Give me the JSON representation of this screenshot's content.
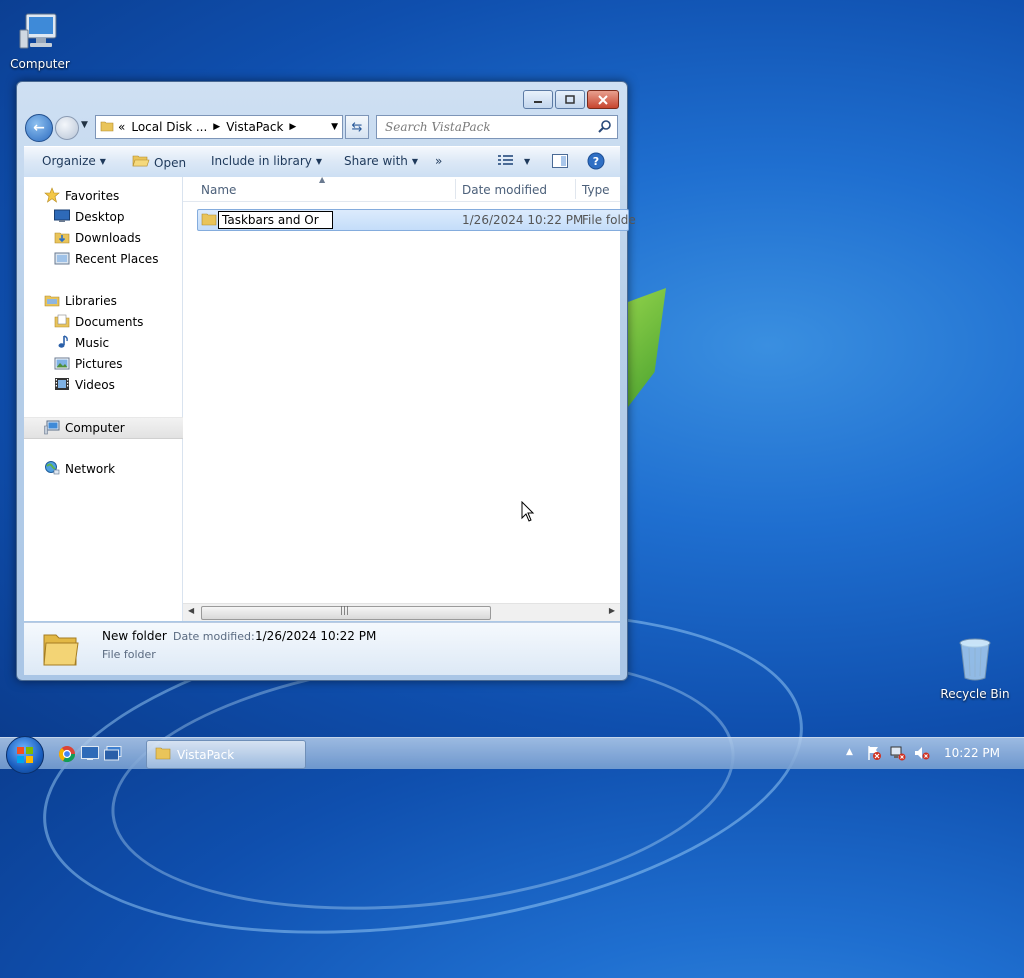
{
  "desktop": {
    "icons": [
      {
        "label": "Computer"
      },
      {
        "label": "Recycle Bin"
      }
    ]
  },
  "window": {
    "address": {
      "overflow": "«",
      "crumbs": [
        "Local Disk ...",
        "VistaPack"
      ]
    },
    "search_placeholder": "Search VistaPack",
    "toolbar": {
      "organize": "Organize",
      "open": "Open",
      "include": "Include in library",
      "share": "Share with",
      "more": "»"
    },
    "nav": {
      "favorites": "Favorites",
      "fav_items": [
        "Desktop",
        "Downloads",
        "Recent Places"
      ],
      "libraries": "Libraries",
      "lib_items": [
        "Documents",
        "Music",
        "Pictures",
        "Videos"
      ],
      "computer": "Computer",
      "network": "Network"
    },
    "columns": {
      "name": "Name",
      "date": "Date modified",
      "type": "Type"
    },
    "files": [
      {
        "name_editing": "Taskbars and Or",
        "date": "1/26/2024 10:22 PM",
        "type": "File folde"
      }
    ],
    "details": {
      "name": "New folder",
      "date_label": "Date modified:",
      "date_value": "1/26/2024 10:22 PM",
      "kind": "File folder"
    }
  },
  "taskbar": {
    "active_app": "VistaPack",
    "clock": "10:22 PM"
  }
}
